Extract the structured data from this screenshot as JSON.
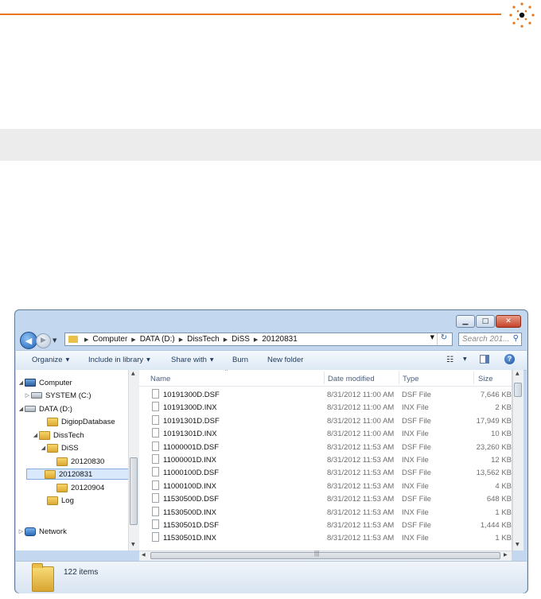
{
  "colors": {
    "accent": "#e8751a",
    "titlebar": "#c3d7ee",
    "selection": "#d9e8fb"
  },
  "window": {
    "caption_buttons": {
      "minimize": "minimize-icon",
      "maximize": "maximize-icon",
      "close": "close-icon"
    },
    "breadcrumbs": [
      "Computer",
      "DATA (D:)",
      "DissTech",
      "DiSS",
      "20120831"
    ],
    "search_placeholder": "Search 201...",
    "toolbar": {
      "organize": "Organize",
      "include": "Include in library",
      "share": "Share with",
      "burn": "Burn",
      "new_folder": "New folder"
    },
    "tree": [
      {
        "label": "Computer",
        "icon": "computer-icon",
        "expander": "◢"
      },
      {
        "label": "SYSTEM (C:)",
        "icon": "drive-icon",
        "expander": "▷"
      },
      {
        "label": "DATA (D:)",
        "icon": "drive-icon",
        "expander": "◢"
      },
      {
        "label": "DigiopDatabase",
        "icon": "folder-icon",
        "expander": ""
      },
      {
        "label": "DissTech",
        "icon": "folder-icon",
        "expander": "◢"
      },
      {
        "label": "DiSS",
        "icon": "folder-icon",
        "expander": "◢"
      },
      {
        "label": "20120830",
        "icon": "folder-icon",
        "expander": ""
      },
      {
        "label": "20120831",
        "icon": "folder-icon",
        "expander": "",
        "selected": true
      },
      {
        "label": "20120904",
        "icon": "folder-icon",
        "expander": ""
      },
      {
        "label": "Log",
        "icon": "folder-icon",
        "expander": ""
      },
      {
        "label": "Network",
        "icon": "network-icon",
        "expander": "▷"
      }
    ],
    "columns": {
      "name": "Name",
      "date": "Date modified",
      "type": "Type",
      "size": "Size"
    },
    "files": [
      {
        "name": "10191300D.DSF",
        "date": "8/31/2012 11:00 AM",
        "type": "DSF File",
        "size": "7,646 KB"
      },
      {
        "name": "10191300D.INX",
        "date": "8/31/2012 11:00 AM",
        "type": "INX File",
        "size": "2 KB"
      },
      {
        "name": "10191301D.DSF",
        "date": "8/31/2012 11:00 AM",
        "type": "DSF File",
        "size": "17,949 KB"
      },
      {
        "name": "10191301D.INX",
        "date": "8/31/2012 11:00 AM",
        "type": "INX File",
        "size": "10 KB"
      },
      {
        "name": "11000001D.DSF",
        "date": "8/31/2012 11:53 AM",
        "type": "DSF File",
        "size": "23,260 KB"
      },
      {
        "name": "11000001D.INX",
        "date": "8/31/2012 11:53 AM",
        "type": "INX File",
        "size": "12 KB"
      },
      {
        "name": "11000100D.DSF",
        "date": "8/31/2012 11:53 AM",
        "type": "DSF File",
        "size": "13,562 KB"
      },
      {
        "name": "11000100D.INX",
        "date": "8/31/2012 11:53 AM",
        "type": "INX File",
        "size": "4 KB"
      },
      {
        "name": "11530500D.DSF",
        "date": "8/31/2012 11:53 AM",
        "type": "DSF File",
        "size": "648 KB"
      },
      {
        "name": "11530500D.INX",
        "date": "8/31/2012 11:53 AM",
        "type": "INX File",
        "size": "1 KB"
      },
      {
        "name": "11530501D.DSF",
        "date": "8/31/2012 11:53 AM",
        "type": "DSF File",
        "size": "1,444 KB"
      },
      {
        "name": "11530501D.INX",
        "date": "8/31/2012 11:53 AM",
        "type": "INX File",
        "size": "1 KB"
      }
    ],
    "status": {
      "count": "122 items"
    }
  }
}
